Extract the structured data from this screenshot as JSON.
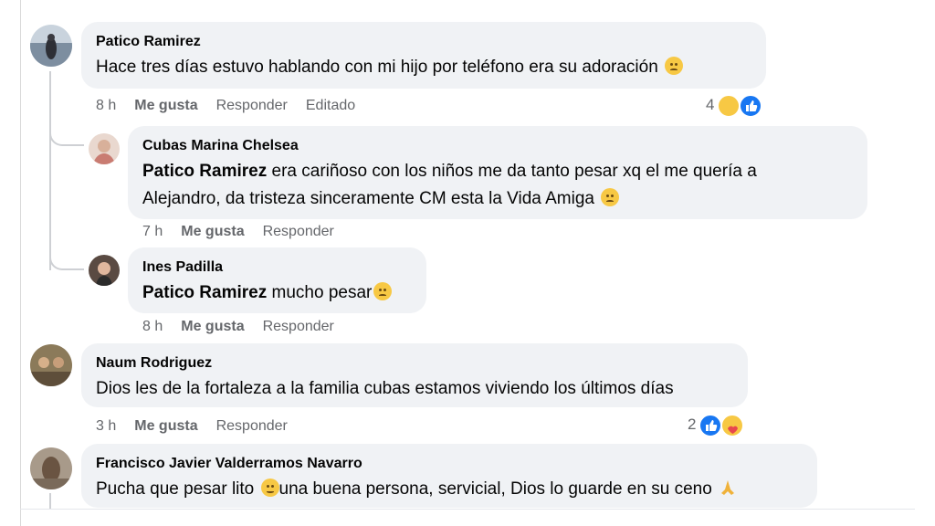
{
  "comments": [
    {
      "author": "Patico Ramirez",
      "text": "Hace tres días estuvo hablando con mi hijo por teléfono era su adoración",
      "emoji": "pleading-face-icon",
      "time": "8 h",
      "like": "Me gusta",
      "reply": "Responder",
      "edited": "Editado",
      "reaction_count": "4",
      "reactions": [
        "sad-icon",
        "like-icon"
      ]
    },
    {
      "author": "Cubas Marina Chelsea",
      "mention": "Patico Ramirez",
      "text_line1": " era cariñoso con los niños me da tanto pesar xq el me quería a",
      "text_line2": "Alejandro, da tristeza sinceramente CM esta la Vida Amiga",
      "emoji": "pensive-face-icon",
      "time": "7 h",
      "like": "Me gusta",
      "reply": "Responder"
    },
    {
      "author": "Ines Padilla",
      "mention": "Patico Ramirez",
      "text": " mucho pesar",
      "emoji": "pensive-face-icon",
      "time": "8 h",
      "like": "Me gusta",
      "reply": "Responder"
    },
    {
      "author": "Naum Rodriguez",
      "text": "Dios les de la fortaleza a la familia cubas estamos viviendo los últimos días",
      "time": "3 h",
      "like": "Me gusta",
      "reply": "Responder",
      "reaction_count": "2",
      "reactions": [
        "like-icon",
        "care-icon"
      ]
    },
    {
      "author": "Francisco Javier Valderramos Navarro",
      "text_a": "Pucha que pesar lito ",
      "text_b": "una buena persona, servicial, Dios lo guarde en su ceno ",
      "emojis": [
        "frowning-face-icon",
        "folded-hands-icon"
      ]
    }
  ],
  "colors": {
    "bubble": "#f0f2f5",
    "secondary_text": "#65676b",
    "like_blue": "#1877f2",
    "emoji_yellow": "#f7c844"
  }
}
